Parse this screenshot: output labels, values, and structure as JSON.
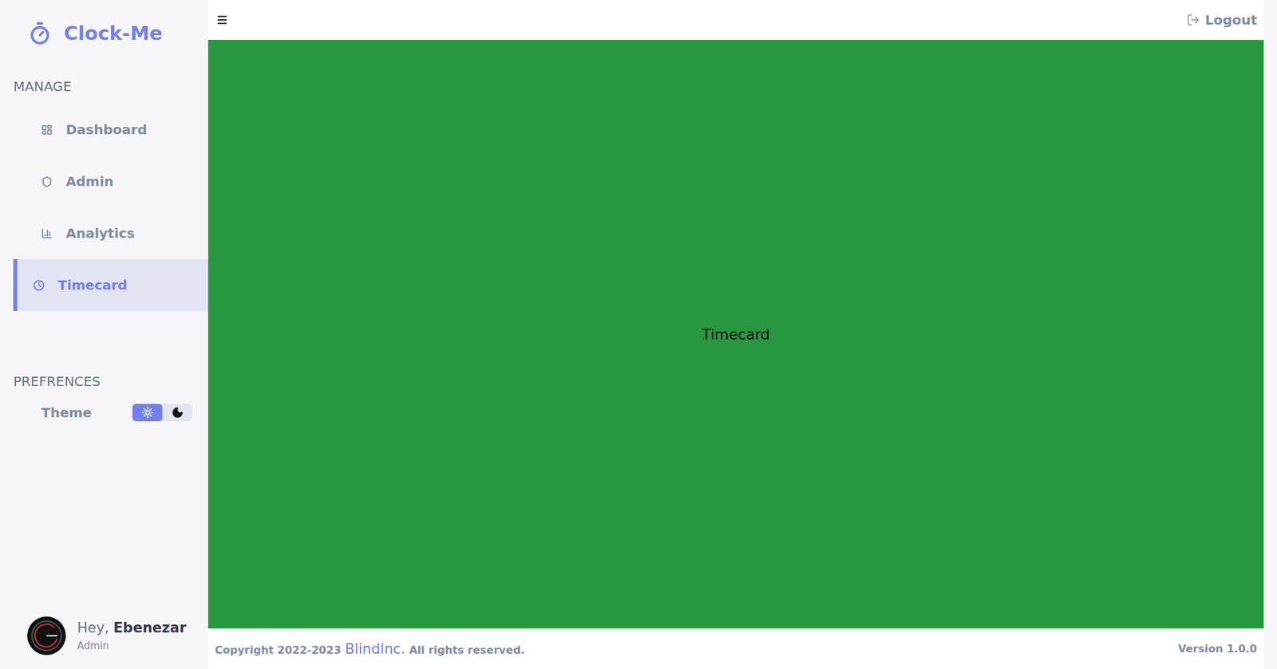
{
  "app": {
    "name": "Clock-Me"
  },
  "sidebar": {
    "title": "MANAGE",
    "items": [
      {
        "label": "Dashboard",
        "selected": false
      },
      {
        "label": "Admin",
        "selected": false
      },
      {
        "label": "Analytics",
        "selected": false
      },
      {
        "label": "Timecard",
        "selected": true
      }
    ]
  },
  "preferences": {
    "title": "PREFRENCES",
    "theme": {
      "label": "Theme",
      "options": [
        {
          "kind": "light",
          "selected": true
        },
        {
          "kind": "dark",
          "selected": false
        }
      ]
    }
  },
  "user": {
    "greeting": "Hey,",
    "name": "Ebenezar",
    "role": "Admin"
  },
  "header": {
    "logout": "Logout"
  },
  "content": {
    "title": "Timecard"
  },
  "footer": {
    "copyright": "Copyright 2022-2023",
    "company": "BlindInc.",
    "rights": "All rights reserved.",
    "version": "Version 1.0.0"
  }
}
